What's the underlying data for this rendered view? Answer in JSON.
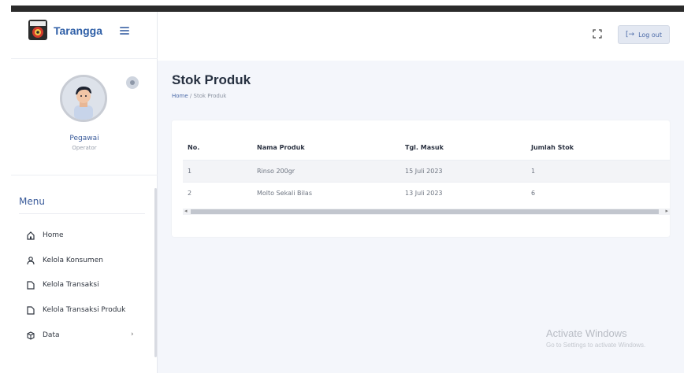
{
  "brand": {
    "name": "Tarangga"
  },
  "profile": {
    "name": "Pegawai",
    "role": "Operator"
  },
  "menu": {
    "title": "Menu",
    "items": [
      {
        "label": "Home",
        "icon": "home-icon"
      },
      {
        "label": "Kelola Konsumen",
        "icon": "user-icon"
      },
      {
        "label": "Kelola Transaksi",
        "icon": "file-icon"
      },
      {
        "label": "Kelola Transaksi Produk",
        "icon": "file-icon"
      },
      {
        "label": "Data",
        "icon": "box-icon",
        "chevron": "›"
      }
    ]
  },
  "header": {
    "logout_label": "Log out",
    "logout_icon": "[→"
  },
  "page": {
    "title": "Stok Produk",
    "breadcrumb": {
      "home": "Home",
      "sep": "/",
      "current": "Stok Produk"
    }
  },
  "table": {
    "columns": [
      "No.",
      "Nama Produk",
      "Tgl. Masuk",
      "Jumlah Stok"
    ],
    "rows": [
      [
        "1",
        "Rinso 200gr",
        "15 Juli 2023",
        "1"
      ],
      [
        "2",
        "Molto Sekali Bilas",
        "13 Juli 2023",
        "6"
      ]
    ]
  },
  "watermark": {
    "line1": "Activate Windows",
    "line2": "Go to Settings to activate Windows."
  },
  "colors": {
    "accent": "#2f5fa7",
    "sidebar_bg": "#ffffff",
    "content_bg": "#f4f6fb"
  }
}
